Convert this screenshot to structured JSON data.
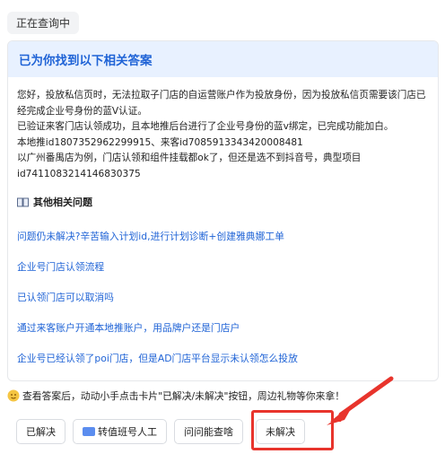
{
  "status": "正在查询中",
  "card": {
    "header": "已为你找到以下相关答案",
    "answer_paragraphs": [
      "您好，投放私信页时，无法拉取子门店的自运营账户作为投放身份，因为投放私信页需要该门店已经完成企业号身份的蓝V认证。",
      "已验证来客门店认领成功，且本地推后台进行了企业号身份的蓝v绑定，已完成功能加白。",
      "本地推id1807352962299915、来客id7085913343420008481",
      "以广州番禺店为例，门店认领和组件挂载都ok了，但还是选不到抖音号，典型项目id7411083214146830375"
    ],
    "related_title": "其他相关问题",
    "related_links": [
      "问题仍未解决?辛苦输入计划id,进行计划诊断+创建雅典娜工单",
      "企业号门店认领流程",
      "已认领门店可以取消吗",
      "通过来客账户开通本地推账户，用品牌户还是门店户",
      "企业号已经认领了poi门店，但是AD门店平台显示未认领怎么投放"
    ]
  },
  "footer_note": "查看答案后，动动小手点击卡片\"已解决/未解决\"按钮，周边礼物等你来拿！",
  "buttons": {
    "resolved": "已解决",
    "transfer": "转值班号人工",
    "ask": "问问能查啥",
    "unresolved": "未解决"
  },
  "colors": {
    "accent_blue": "#1f63d6",
    "header_bg": "#e8f1ff",
    "highlight_red": "#e8342c"
  }
}
